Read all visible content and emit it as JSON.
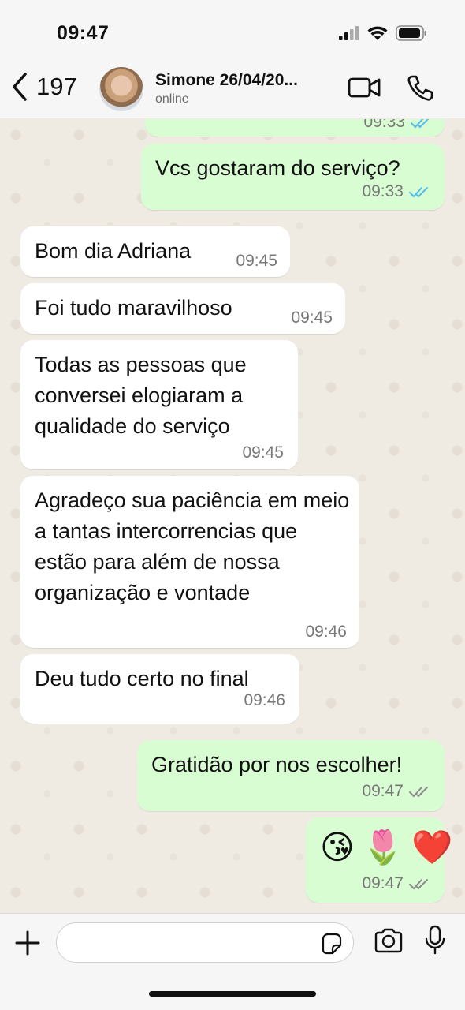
{
  "status_bar": {
    "time": "09:47"
  },
  "header": {
    "back_count": "197",
    "contact_name": "Simone 26/04/20...",
    "contact_status": "online"
  },
  "messages": [
    {
      "dir": "out",
      "text": "",
      "time": "09:33",
      "ticks": "read"
    },
    {
      "dir": "out",
      "text": "Vcs gostaram do serviço?",
      "time": "09:33",
      "ticks": "read"
    },
    {
      "dir": "in",
      "text": "Bom dia Adriana",
      "time": "09:45"
    },
    {
      "dir": "in",
      "text": "Foi tudo  maravilhoso",
      "time": "09:45"
    },
    {
      "dir": "in",
      "text": "Todas as pessoas  que conversei elogiaram a qualidade do serviço",
      "time": "09:45"
    },
    {
      "dir": "in",
      "text": "Agradeço  sua paciência  em meio a tantas intercorrencias que estão  para além  de nossa organização  e vontade",
      "time": "09:46"
    },
    {
      "dir": "in",
      "text": "Deu tudo  certo  no final",
      "time": "09:46"
    },
    {
      "dir": "out",
      "text": "Gratidão por nos escolher!",
      "time": "09:47",
      "ticks": "delivered"
    },
    {
      "dir": "out",
      "emojis": [
        "😘",
        "🌷",
        "❤️"
      ],
      "time": "09:47",
      "ticks": "delivered"
    }
  ],
  "input": {
    "placeholder": ""
  },
  "colors": {
    "outgoing": "#d9fdd3",
    "incoming": "#ffffff",
    "read_tick": "#53bdeb",
    "chat_bg": "#efeae2"
  },
  "icons": [
    "back-chevron-icon",
    "video-call-icon",
    "phone-call-icon",
    "plus-icon",
    "sticker-icon",
    "camera-icon",
    "microphone-icon",
    "signal-icon",
    "wifi-icon",
    "battery-icon"
  ]
}
